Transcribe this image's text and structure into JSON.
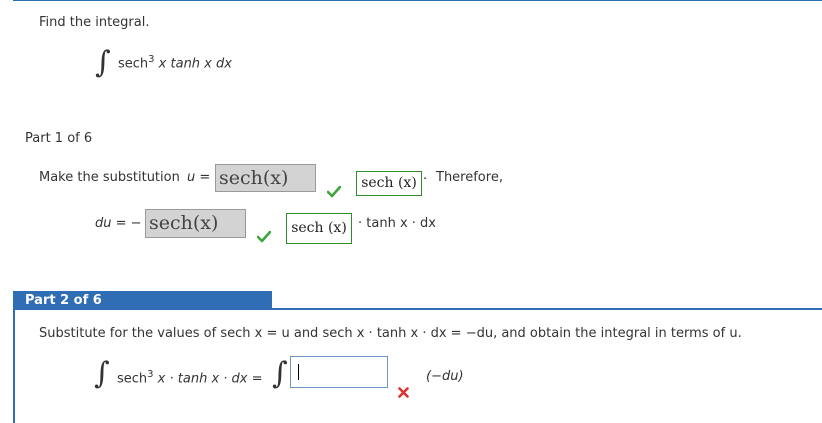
{
  "question": {
    "prompt": "Find the integral.",
    "integrand_func": "sech",
    "integrand_power": "3",
    "integrand_rest": " x tanh x dx"
  },
  "part1": {
    "header": "Part 1 of 6",
    "instruction": "Make the substitution",
    "u_label": "u =",
    "u_value": "sech(x)",
    "boxed_answer_1": "sech (x)",
    "therefore": "Therefore,",
    "du_label": "du = −",
    "du_value": "sech(x)",
    "boxed_answer_2": "sech (x)",
    "du_rest": "· tanh x · dx",
    "dot_after_box": "·"
  },
  "part2": {
    "header": "Part 2 of 6",
    "instruction": "Substitute for the values of  sech x = u and sech x · tanh x · dx = −du,  and obtain the integral in terms of u.",
    "integrand_func": "sech",
    "integrand_power": "3",
    "integrand_rest": " x · tanh x · dx =",
    "rhs_hint": "(−du)",
    "answer_value": ""
  },
  "colors": {
    "accent_blue": "#2f6db5",
    "correct_green": "#2e8b2e",
    "wrong_red": "#d9322f",
    "filled_input_bg": "#d3d3d3"
  },
  "icons": {
    "correct": "check-mark-icon",
    "incorrect": "x-mark-icon"
  }
}
